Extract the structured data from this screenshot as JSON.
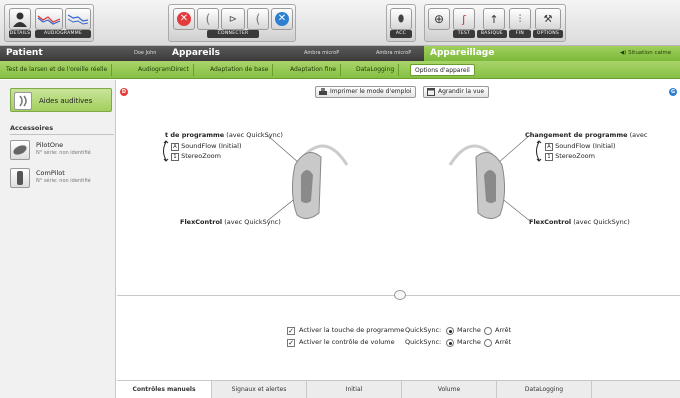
{
  "toolbar": {
    "details_label": "DETAILS",
    "audiogramme_label": "AUDIOGRAMME",
    "connecter_label": "CONNECTER",
    "acc_label": "ACC",
    "test_label": "TEST",
    "basique_label": "BASIQUE",
    "fin_label": "FIN",
    "options_label": "OPTIONS"
  },
  "header": {
    "patient_label": "Patient",
    "patient_name": "Doe John",
    "appareils_label": "Appareils",
    "device_left": "Ambra microP",
    "device_right": "Ambra microP",
    "appareillage_label": "Appareillage",
    "situation_label": "Situation calme"
  },
  "tabs": [
    {
      "label": "Test de larsen et de l'oreille réelle"
    },
    {
      "label": "AudiogramDirect"
    },
    {
      "label": "Adaptation de base"
    },
    {
      "label": "Adaptation fine"
    },
    {
      "label": "DataLogging"
    },
    {
      "label": "Options d'appareil"
    }
  ],
  "sidebar": {
    "aides_label": "Aides auditives",
    "accessoires_label": "Accessoires",
    "items": [
      {
        "name": "PilotOne",
        "serial": "N° série: non identifié"
      },
      {
        "name": "ComPilot",
        "serial": "N° série: non identifié"
      }
    ]
  },
  "main": {
    "badge_left": "D",
    "badge_right": "G",
    "print_label": "Imprimer le mode d'emploi",
    "enlarge_label": "Agrandir la vue",
    "left": {
      "prog_title_bold": "t de programme",
      "prog_title_rest": " (avec QuickSync)",
      "prog_a_letter": "A",
      "prog_a_text": "SoundFlow (Initial)",
      "prog_1_letter": "1",
      "prog_1_text": "StereoZoom",
      "flex_bold": "FlexControl",
      "flex_rest": " (avec QuickSync)"
    },
    "right": {
      "prog_title_bold": "Changement de programme",
      "prog_title_rest": " (avec",
      "prog_a_letter": "A",
      "prog_a_text": "SoundFlow (Initial)",
      "prog_1_letter": "1",
      "prog_1_text": "StereoZoom",
      "flex_bold": "FlexControl",
      "flex_rest": " (avec QuickSync)"
    },
    "options": [
      {
        "label": "Activer la touche de programme",
        "quicksync": "QuickSync:",
        "on": "Marche",
        "off": "Arrêt"
      },
      {
        "label": "Activer le contrôle de volume",
        "quicksync": "QuickSync:",
        "on": "Marche",
        "off": "Arrêt"
      }
    ]
  },
  "bottom_tabs": [
    {
      "label": "Contrôles manuels"
    },
    {
      "label": "Signaux et alertes"
    },
    {
      "label": "Initial"
    },
    {
      "label": "Volume"
    },
    {
      "label": "DataLogging"
    }
  ]
}
